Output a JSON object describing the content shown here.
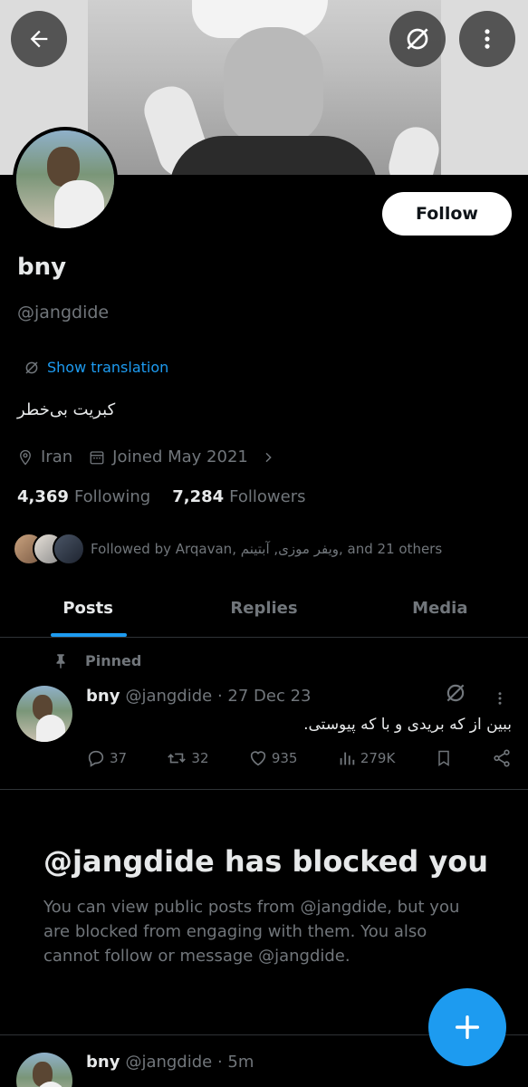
{
  "header": {
    "back_icon": "arrow-left-icon",
    "nolink_icon": "translate-off-icon",
    "more_icon": "more-vertical-icon"
  },
  "profile": {
    "name": "bny",
    "handle": "@jangdide",
    "follow_label": "Follow",
    "translation_label": "Show translation",
    "bio": "کبریت بی‌خطر",
    "location": "Iran",
    "joined": "Joined May 2021",
    "following_count": "4,369",
    "following_label": "Following",
    "followers_count": "7,284",
    "followers_label": "Followers",
    "followed_by": "Followed by Arqavan, ویفر موزی, آبتینم, and 21 others"
  },
  "tabs": [
    {
      "label": "Posts",
      "active": true
    },
    {
      "label": "Replies",
      "active": false
    },
    {
      "label": "Media",
      "active": false
    }
  ],
  "pinned_post": {
    "pinned_label": "Pinned",
    "name": "bny",
    "handle_time": "@jangdide · 27 Dec 23",
    "text": "ببین از که بریدی و با که پیوستی.",
    "replies": "37",
    "reposts": "32",
    "likes": "935",
    "views": "279K"
  },
  "blocked": {
    "title": "@jangdide has blocked you",
    "description": "You can view public posts from @jangdide, but you are blocked from engaging with them. You also cannot follow or message @jangdide."
  },
  "bottom_post": {
    "name": "bny",
    "handle_time": "@jangdide · 5m"
  },
  "colors": {
    "accent": "#1d9bf0",
    "background": "#000000",
    "muted": "#71767b",
    "text": "#e7e9ea"
  }
}
